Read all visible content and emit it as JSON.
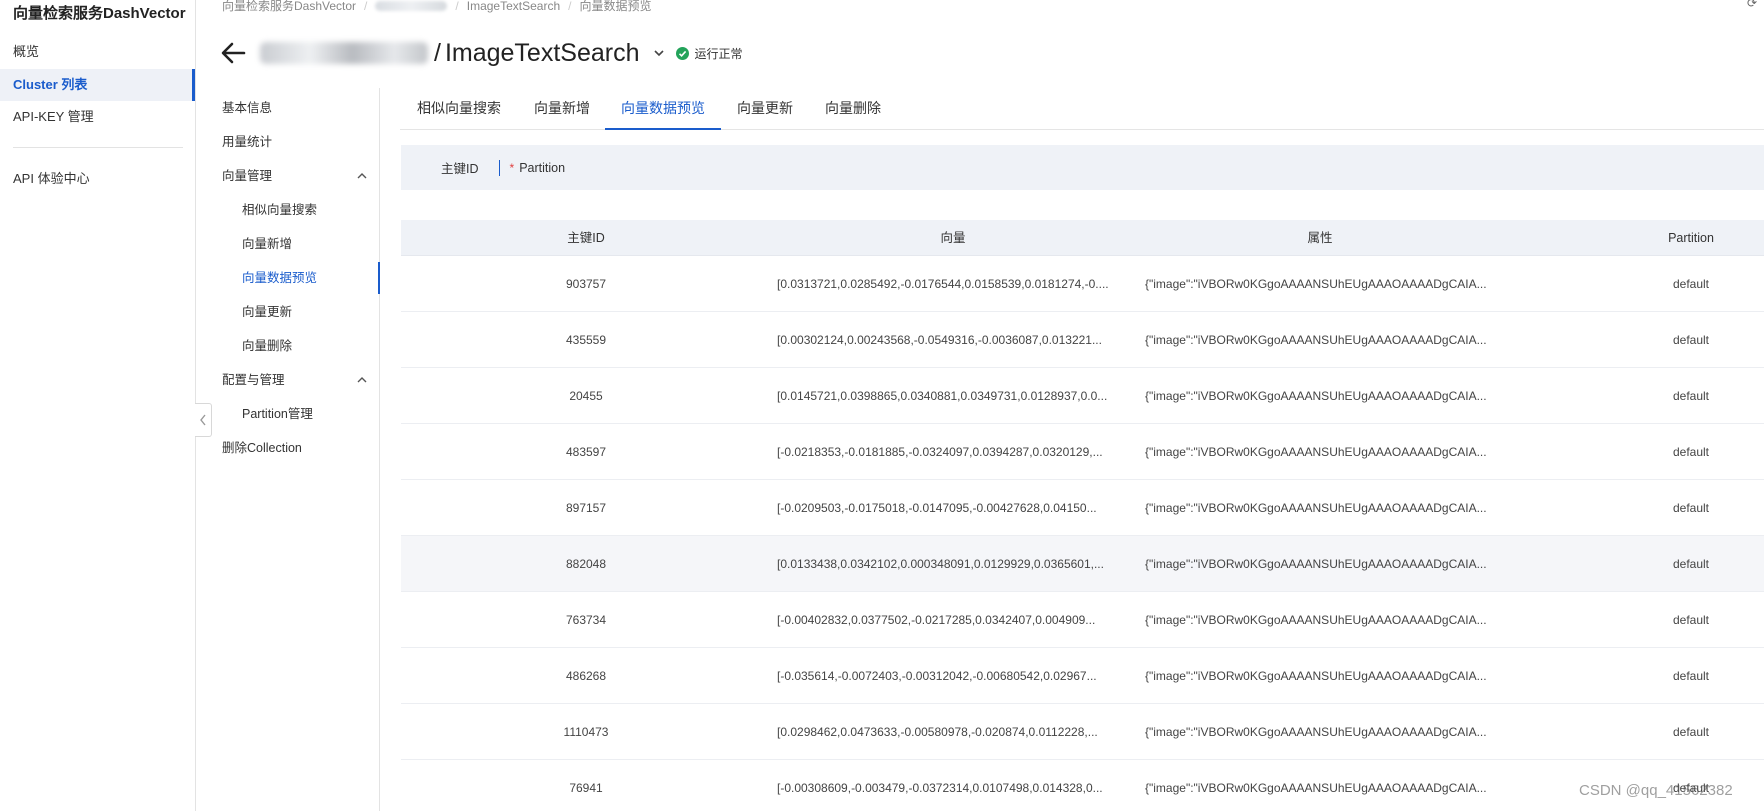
{
  "sidebar": {
    "brand": "向量检索服务DashVector",
    "items": [
      {
        "label": "概览",
        "active": false
      },
      {
        "label": "Cluster 列表",
        "active": true
      },
      {
        "label": "API-KEY 管理",
        "active": false
      },
      {
        "label": "API 体验中心",
        "active": false
      }
    ]
  },
  "breadcrumb": [
    "向量检索服务DashVector",
    "",
    "ImageTextSearch",
    "向量数据预览"
  ],
  "header": {
    "title": "ImageTextSearch",
    "title_prefix": "/",
    "status": "运行正常",
    "status_color": "#23a35a"
  },
  "subnav": {
    "items": [
      {
        "label": "基本信息",
        "level": 1
      },
      {
        "label": "用量统计",
        "level": 1
      },
      {
        "label": "向量管理",
        "level": 1,
        "expandable": true
      },
      {
        "label": "相似向量搜索",
        "level": 2
      },
      {
        "label": "向量新增",
        "level": 2
      },
      {
        "label": "向量数据预览",
        "level": 2,
        "active": true
      },
      {
        "label": "向量更新",
        "level": 2
      },
      {
        "label": "向量删除",
        "level": 2
      },
      {
        "label": "配置与管理",
        "level": 1,
        "expandable": true
      },
      {
        "label": "Partition管理",
        "level": 2
      },
      {
        "label": "删除Collection",
        "level": 1
      }
    ]
  },
  "tabs": [
    {
      "label": "相似向量搜索"
    },
    {
      "label": "向量新增"
    },
    {
      "label": "向量数据预览",
      "active": true
    },
    {
      "label": "向量更新"
    },
    {
      "label": "向量删除"
    }
  ],
  "filter": {
    "key_label": "主键ID",
    "required_mark": "*",
    "partition_label": "Partition"
  },
  "table": {
    "columns": [
      "主键ID",
      "向量",
      "属性",
      "Partition"
    ],
    "rows": [
      {
        "id": "903757",
        "vector": "[0.0313721,0.0285492,-0.0176544,0.0158539,0.0181274,-0....",
        "attr": "{\"image\":\"iVBORw0KGgoAAAANSUhEUgAAAOAAAADgCAIA...",
        "partition": "default"
      },
      {
        "id": "435559",
        "vector": "[0.00302124,0.00243568,-0.0549316,-0.0036087,0.013221...",
        "attr": "{\"image\":\"iVBORw0KGgoAAAANSUhEUgAAAOAAAADgCAIA...",
        "partition": "default"
      },
      {
        "id": "20455",
        "vector": "[0.0145721,0.0398865,0.0340881,0.0349731,0.0128937,0.0...",
        "attr": "{\"image\":\"iVBORw0KGgoAAAANSUhEUgAAAOAAAADgCAIA...",
        "partition": "default"
      },
      {
        "id": "483597",
        "vector": "[-0.0218353,-0.0181885,-0.0324097,0.0394287,0.0320129,...",
        "attr": "{\"image\":\"iVBORw0KGgoAAAANSUhEUgAAAOAAAADgCAIA...",
        "partition": "default"
      },
      {
        "id": "897157",
        "vector": "[-0.0209503,-0.0175018,-0.0147095,-0.00427628,0.04150...",
        "attr": "{\"image\":\"iVBORw0KGgoAAAANSUhEUgAAAOAAAADgCAIA...",
        "partition": "default"
      },
      {
        "id": "882048",
        "vector": "[0.0133438,0.0342102,0.000348091,0.0129929,0.0365601,...",
        "attr": "{\"image\":\"iVBORw0KGgoAAAANSUhEUgAAAOAAAADgCAIA...",
        "partition": "default",
        "highlighted": true
      },
      {
        "id": "763734",
        "vector": "[-0.00402832,0.0377502,-0.0217285,0.0342407,0.004909...",
        "attr": "{\"image\":\"iVBORw0KGgoAAAANSUhEUgAAAOAAAADgCAIA...",
        "partition": "default"
      },
      {
        "id": "486268",
        "vector": "[-0.035614,-0.0072403,-0.00312042,-0.00680542,0.02967...",
        "attr": "{\"image\":\"iVBORw0KGgoAAAANSUhEUgAAAOAAAADgCAIA...",
        "partition": "default"
      },
      {
        "id": "1110473",
        "vector": "[0.0298462,0.0473633,-0.00580978,-0.020874,0.0112228,...",
        "attr": "{\"image\":\"iVBORw0KGgoAAAANSUhEUgAAAOAAAADgCAIA...",
        "partition": "default"
      },
      {
        "id": "76941",
        "vector": "[-0.00308609,-0.003479,-0.0372314,0.0107498,0.014328,0...",
        "attr": "{\"image\":\"iVBORw0KGgoAAAANSUhEUgAAAOAAAADgCAIA...",
        "partition": "default"
      }
    ]
  },
  "watermark": "CSDN @qq_41562382",
  "colors": {
    "accent": "#1a5ccc",
    "status_ok": "#23a35a",
    "header_bg": "#eff2f7"
  }
}
